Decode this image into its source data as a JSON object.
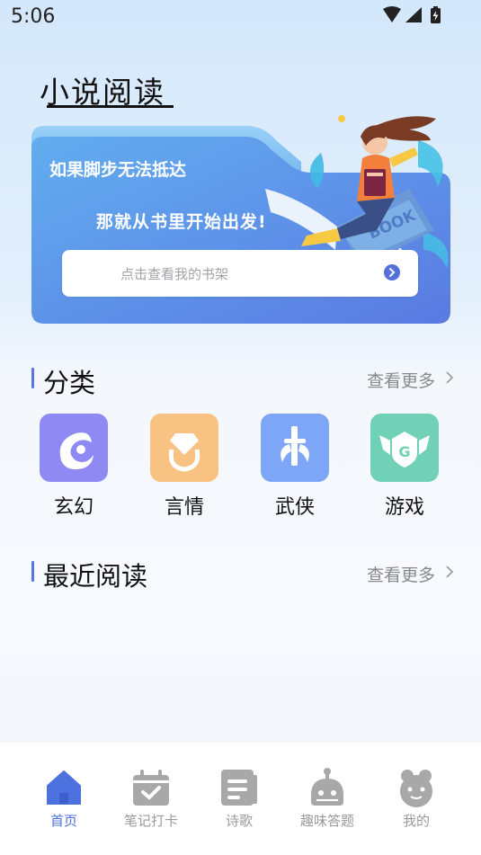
{
  "status_bar": {
    "time": "5:06"
  },
  "app": {
    "title": "小说阅读"
  },
  "banner": {
    "line1": "如果脚步无法抵达",
    "line2": "那就从书里开始出发!",
    "search_placeholder": "点击查看我的书架",
    "book_cover_text": "BOOK"
  },
  "categories_section": {
    "title": "分类",
    "more_label": "查看更多",
    "items": [
      {
        "label": "玄幻",
        "color": "#8f8af3",
        "icon": "phoenix-icon"
      },
      {
        "label": "言情",
        "color": "#f8c282",
        "icon": "diamond-ring-icon"
      },
      {
        "label": "武侠",
        "color": "#7ea6f7",
        "icon": "sword-icon"
      },
      {
        "label": "游戏",
        "color": "#70d1b7",
        "icon": "game-wings-icon"
      }
    ]
  },
  "recent_section": {
    "title": "最近阅读",
    "more_label": "查看更多"
  },
  "tab_bar": {
    "active_color": "#4d72e0",
    "inactive_color": "#9a9a9a",
    "items": [
      {
        "label": "首页",
        "icon": "home-icon",
        "active": true
      },
      {
        "label": "笔记打卡",
        "icon": "calendar-check-icon",
        "active": false
      },
      {
        "label": "诗歌",
        "icon": "document-icon",
        "active": false
      },
      {
        "label": "趣味答题",
        "icon": "robot-icon",
        "active": false
      },
      {
        "label": "我的",
        "icon": "profile-icon",
        "active": false
      }
    ]
  }
}
